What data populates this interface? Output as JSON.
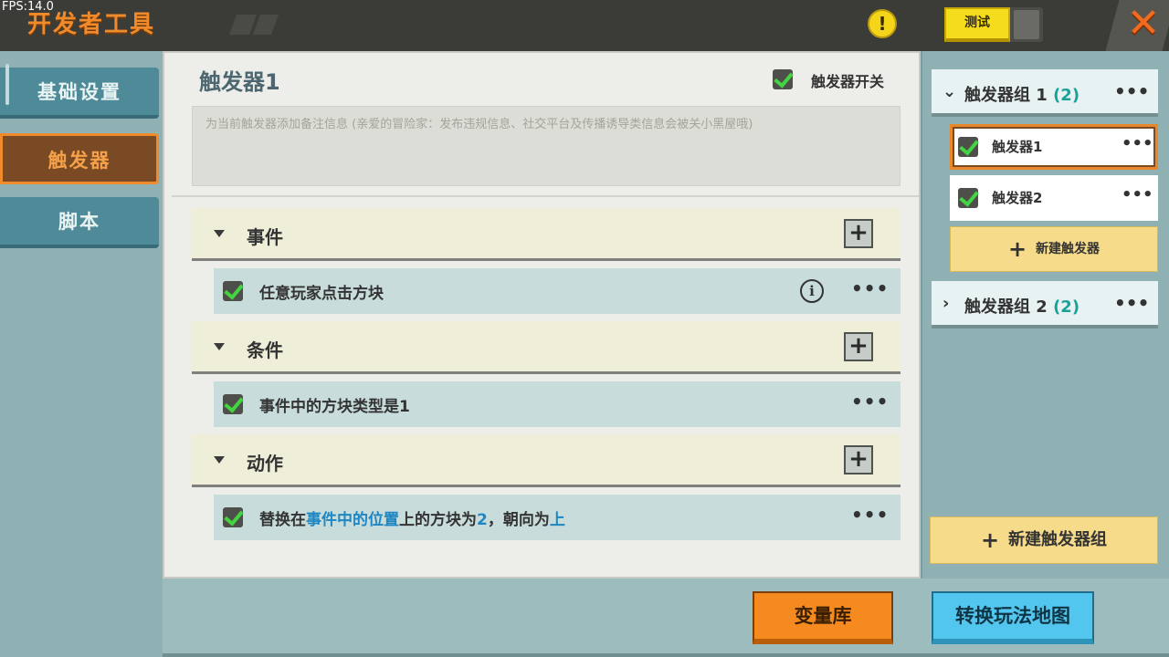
{
  "topbar": {
    "fps": "FPS:14.0",
    "title": "开发者工具",
    "alert_icon": "!",
    "test_label": "测试",
    "close_icon": "✕"
  },
  "leftnav": {
    "items": [
      {
        "label": "基础设置",
        "active": false
      },
      {
        "label": "触发器",
        "active": true
      },
      {
        "label": "脚本",
        "active": false
      }
    ]
  },
  "main": {
    "title": "触发器1",
    "switch_label": "触发器开关",
    "switch_checked": true,
    "note_placeholder": "为当前触发器添加备注信息 (亲爱的冒险家：发布违规信息、社交平台及传播诱导类信息会被关小黑屋哦)",
    "sections": [
      {
        "label": "事件",
        "plus": "+"
      },
      {
        "label": "条件",
        "plus": "+"
      },
      {
        "label": "动作",
        "plus": "+"
      }
    ],
    "event_row": {
      "text": "任意玩家点击方块",
      "info_icon": "i",
      "dots": "•••"
    },
    "condition_row": {
      "text": "事件中的方块类型是1",
      "dots": "•••"
    },
    "action_row": {
      "p1": "替换在",
      "p2": "事件中的位置",
      "p3": "上的方块为",
      "p4": "2",
      "p5": "，朝向为",
      "p6": "上",
      "dots": "•••"
    }
  },
  "rightpanel": {
    "group1": {
      "chevron": "⌄",
      "name": "触发器组 1",
      "count": "(2)",
      "dots": "•••"
    },
    "triggers": [
      {
        "name": "触发器1",
        "dots": "•••",
        "selected": true
      },
      {
        "name": "触发器2",
        "dots": "•••",
        "selected": false
      }
    ],
    "new_trigger": "新建触发器",
    "group2": {
      "chevron": "›",
      "name": "触发器组 2",
      "count": "(2)",
      "dots": "•••"
    },
    "new_group": "新建触发器组",
    "plus": "+"
  },
  "bottom": {
    "variable_library": "变量库",
    "convert_map": "转换玩法地图"
  },
  "colors": {
    "accent_orange": "#f08a2a",
    "teal_panel": "#8fb1b3",
    "blue_link": "#1e86c2",
    "check_green": "#43d43f"
  }
}
